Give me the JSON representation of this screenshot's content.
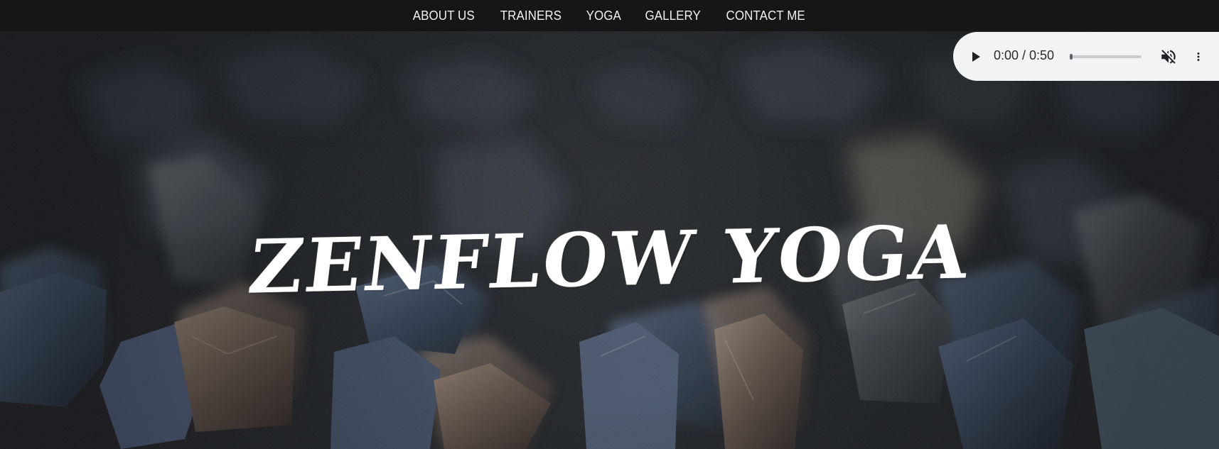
{
  "navigation": {
    "items": [
      {
        "label": "ABOUT US"
      },
      {
        "label": "TRAINERS"
      },
      {
        "label": "YOGA"
      },
      {
        "label": "GALLERY"
      },
      {
        "label": "CONTACT ME"
      }
    ]
  },
  "hero": {
    "title": "Zenflow yoga"
  },
  "audio_player": {
    "time_display": "0:00 / 0:50",
    "progress": 0,
    "icons": {
      "play": "play-icon",
      "mute": "volume-muted-icon",
      "more": "more-vert-icon"
    }
  },
  "colors": {
    "nav_background": "#161616",
    "nav_text": "#f2f2f2",
    "hero_text": "#ffffff",
    "player_background": "#f1f3f4",
    "player_icon": "#202124"
  }
}
